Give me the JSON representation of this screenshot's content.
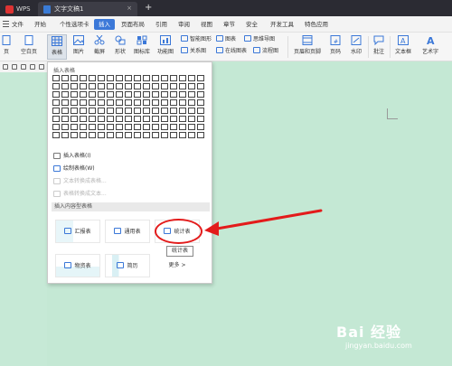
{
  "titlebar": {
    "app_tab": "WPS",
    "doc_tab": "文字文稿1",
    "new_tab": "+"
  },
  "menubar": {
    "items": [
      "文件",
      "开始",
      "个性选项卡",
      "插入",
      "页面布局",
      "引用",
      "审阅",
      "视图",
      "章节",
      "安全",
      "开发工具",
      "特色应用"
    ],
    "active": "插入"
  },
  "ribbon": {
    "buttons": [
      "页",
      "空白页",
      "表格",
      "图片",
      "截屏",
      "形状",
      "图标库",
      "功能图",
      "页眉和页脚",
      "页码",
      "水印",
      "批注",
      "文本框",
      "艺术字"
    ],
    "small": [
      "智能图形",
      "图表",
      "思维导图",
      "关系图",
      "在线图表",
      "流程图"
    ]
  },
  "panel": {
    "title": "插入表格",
    "menu": [
      {
        "label": "插入表格(I)",
        "enabled": true
      },
      {
        "label": "绘制表格(W)",
        "enabled": true
      },
      {
        "label": "文本转换成表格...",
        "enabled": false
      },
      {
        "label": "表格转换成文本...",
        "enabled": false
      }
    ],
    "section": "插入内容型表格",
    "cards": [
      "汇报表",
      "通用表",
      "统计表",
      "物资表",
      "简历",
      "更多 >"
    ],
    "tooltip": "统计表"
  },
  "watermark": {
    "main": "Bai 经验",
    "sub": "jingyan.baidu.com"
  },
  "colors": {
    "accent": "#3b78d8",
    "annotation": "#e31b1b",
    "document_bg": "#c4e8d4",
    "titlebar_bg": "#2b2b33"
  }
}
